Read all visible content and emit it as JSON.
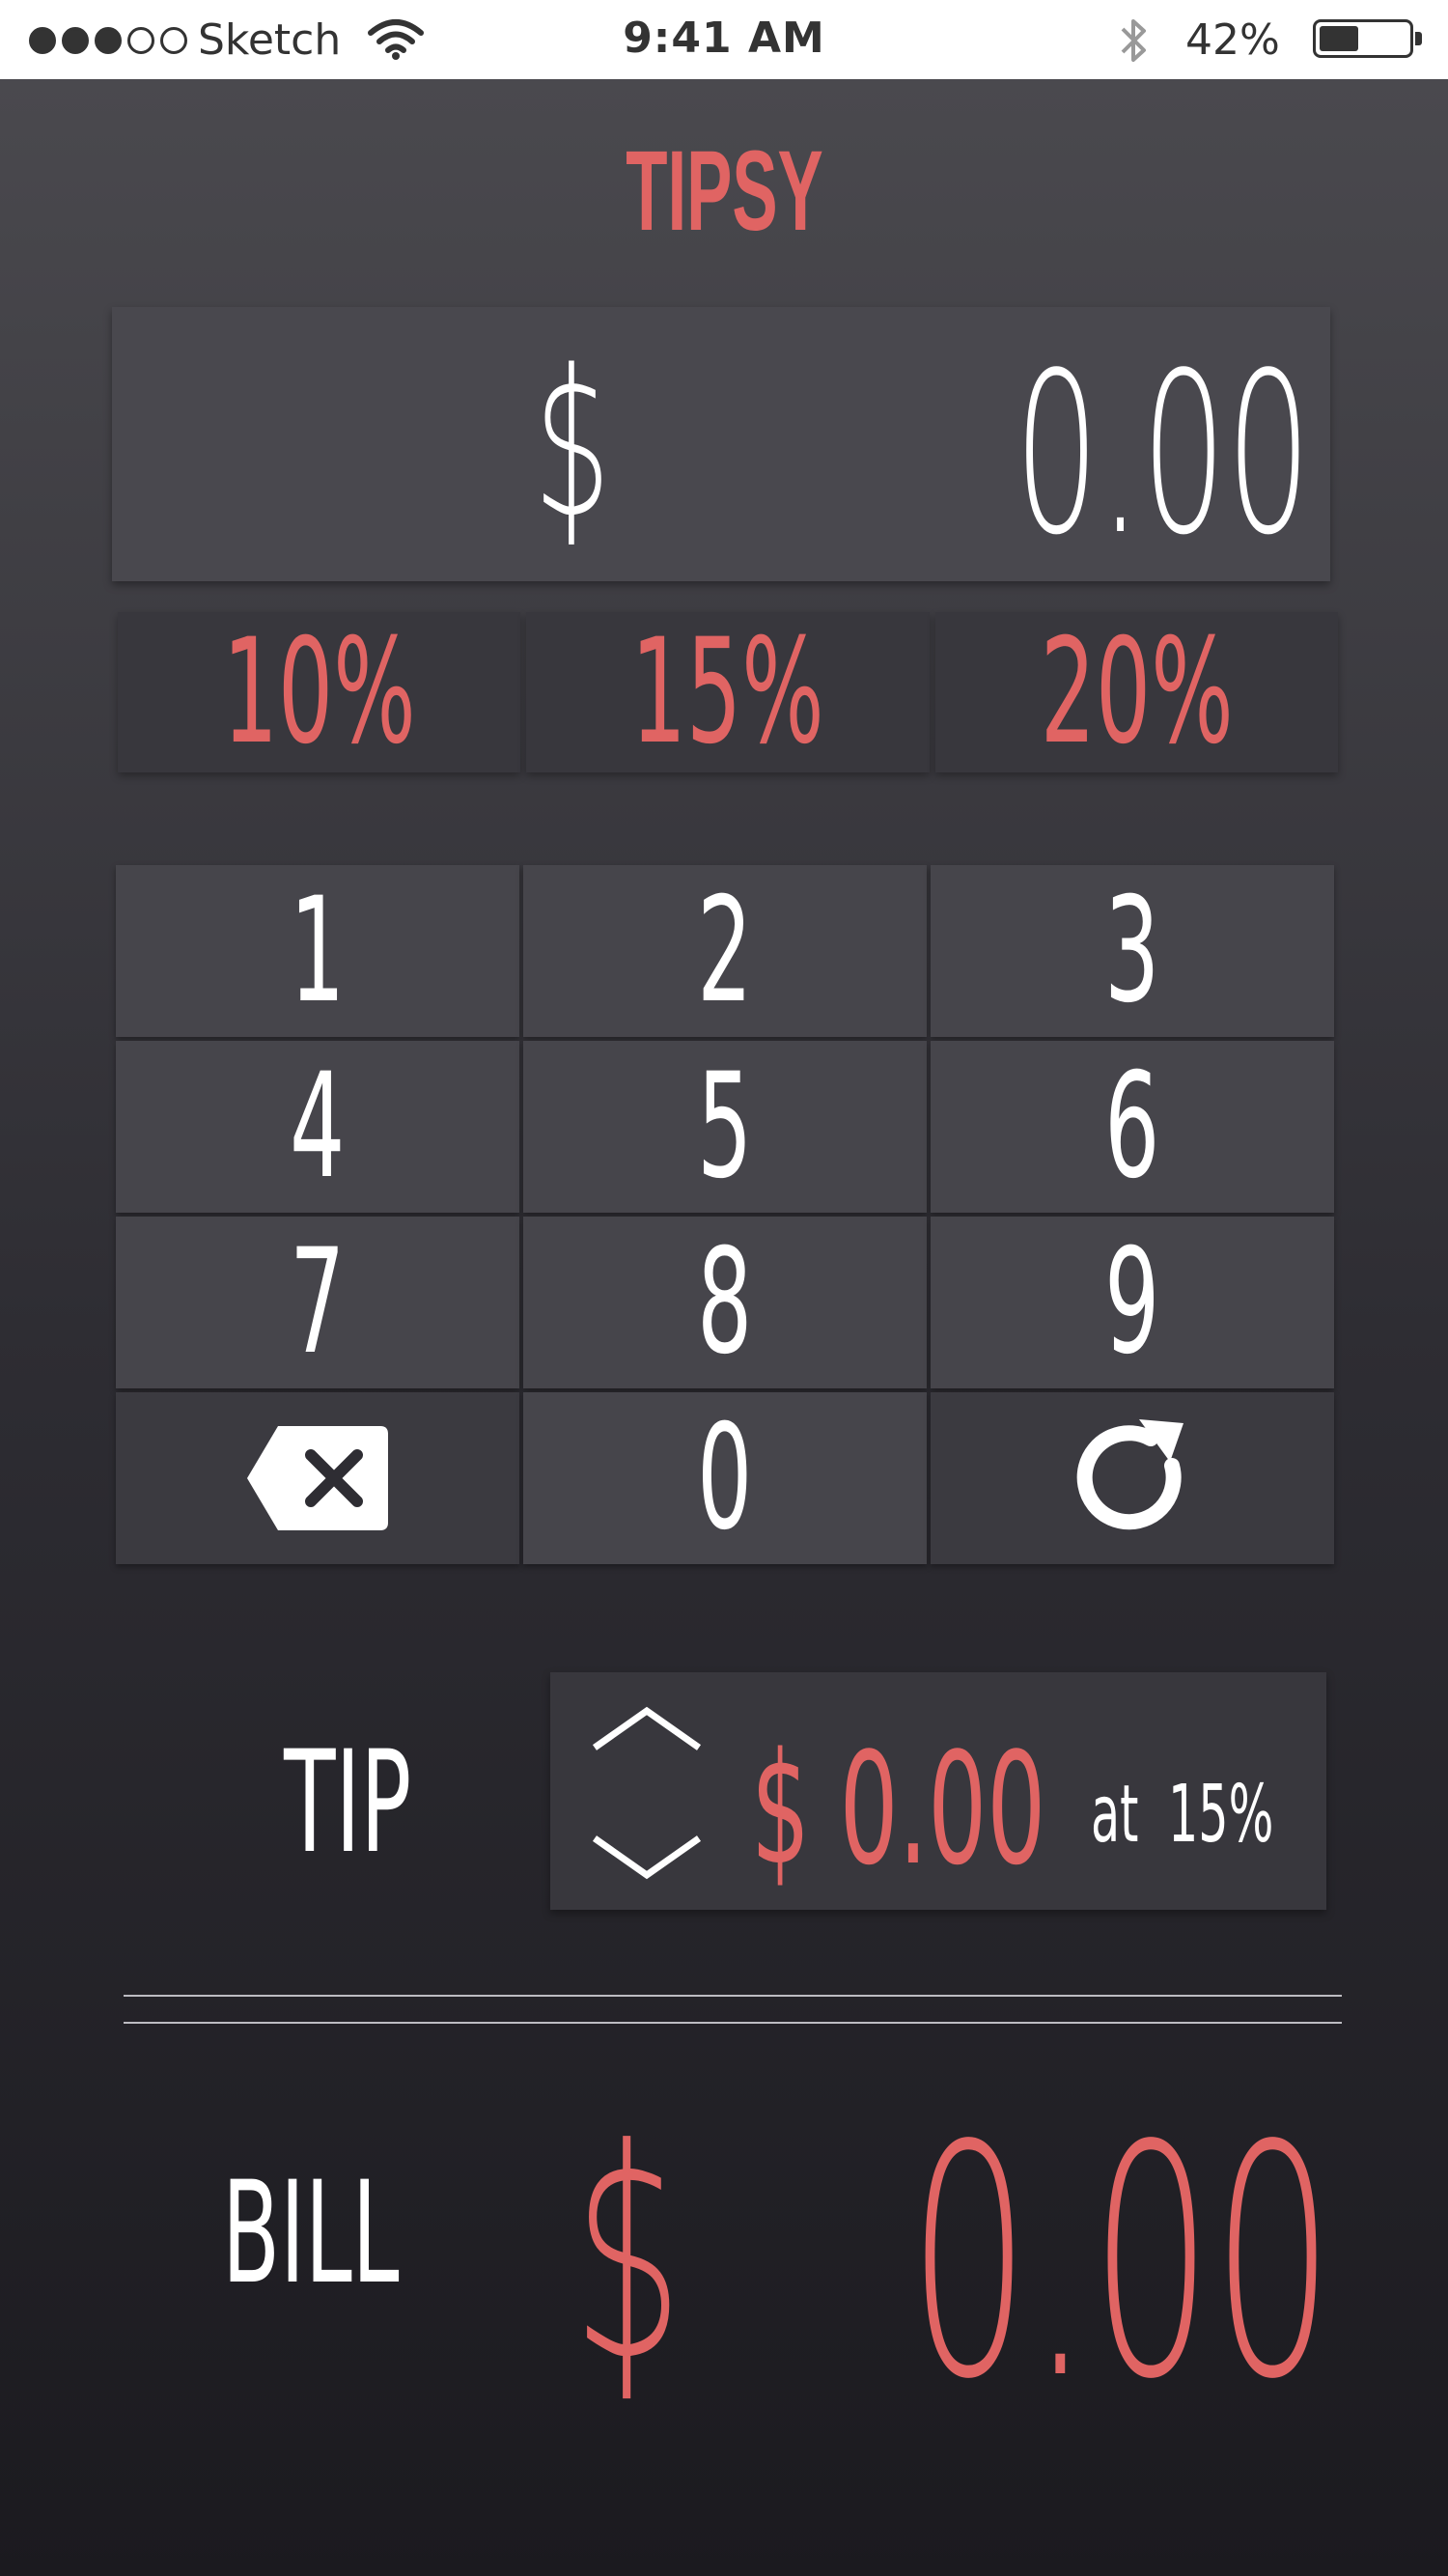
{
  "status_bar": {
    "carrier": "Sketch",
    "time": "9:41 AM",
    "battery_percent": "42%",
    "battery_level": 0.42,
    "signal_bars_filled": 3,
    "signal_bars_total": 5
  },
  "app": {
    "title": "TIPSY",
    "accent_color": "#e06463"
  },
  "display": {
    "currency_symbol": "$",
    "amount": "0.00"
  },
  "percent_options": [
    {
      "label": "10%"
    },
    {
      "label": "15%"
    },
    {
      "label": "20%"
    }
  ],
  "keypad": {
    "keys": [
      "1",
      "2",
      "3",
      "4",
      "5",
      "6",
      "7",
      "8",
      "9",
      "0"
    ],
    "backspace_icon": "backspace-icon",
    "reset_icon": "refresh-icon"
  },
  "tip": {
    "label": "TIP",
    "amount": "$ 0.00",
    "at_label": "at",
    "rate": "15%"
  },
  "bill": {
    "label": "BILL",
    "currency_symbol": "$",
    "amount": "0.00"
  }
}
